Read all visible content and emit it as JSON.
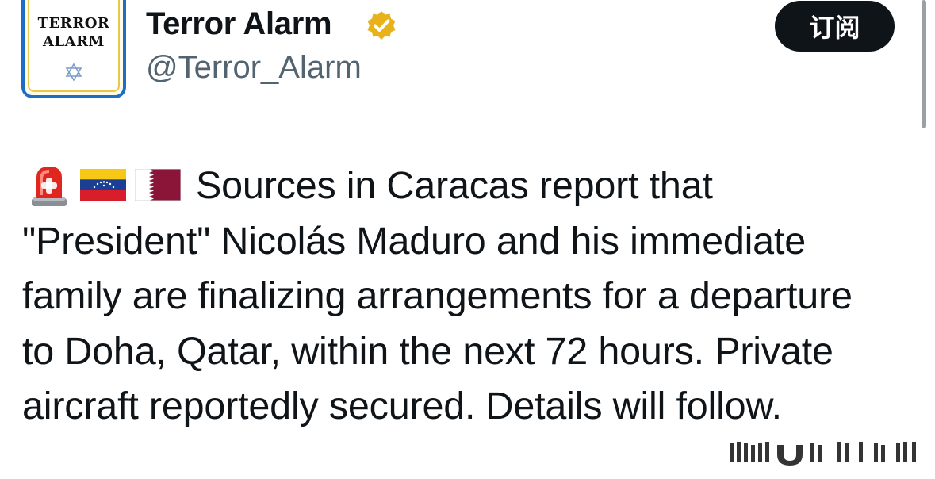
{
  "author": {
    "avatar_logo_line1": "TERROR",
    "avatar_logo_line2": "ALARM",
    "display_name": "Terror Alarm",
    "handle": "@Terror_Alarm",
    "verified_badge_color": "#e8b21a"
  },
  "subscribe_button": {
    "label": "订阅"
  },
  "tweet": {
    "emojis": [
      "siren-emoji",
      "venezuela-flag-emoji",
      "qatar-flag-emoji"
    ],
    "lines": [
      "Sources in Caracas report that",
      "\"President\" Nicolás Maduro and his immediate",
      "family are finalizing arrangements for a departure",
      "to Doha, Qatar, within the next 72 hours. Private",
      "aircraft reportedly secured. Details will follow."
    ]
  },
  "colors": {
    "text": "#0f1419",
    "handle": "#536471",
    "button_bg": "#0f1419",
    "avatar_border": "#1d6fc4"
  }
}
